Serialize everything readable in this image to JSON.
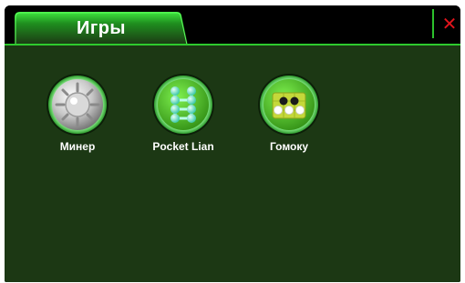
{
  "window": {
    "title": "Игры",
    "close_symbol": "✕"
  },
  "apps": [
    {
      "label": "Минер",
      "icon": "mine-icon"
    },
    {
      "label": "Pocket Lian",
      "icon": "connect-dots-icon"
    },
    {
      "label": "Гомоку",
      "icon": "gomoku-board-icon"
    }
  ],
  "colors": {
    "accent": "#2ecb2e",
    "background": "#1c3814",
    "close": "#e0141c"
  }
}
